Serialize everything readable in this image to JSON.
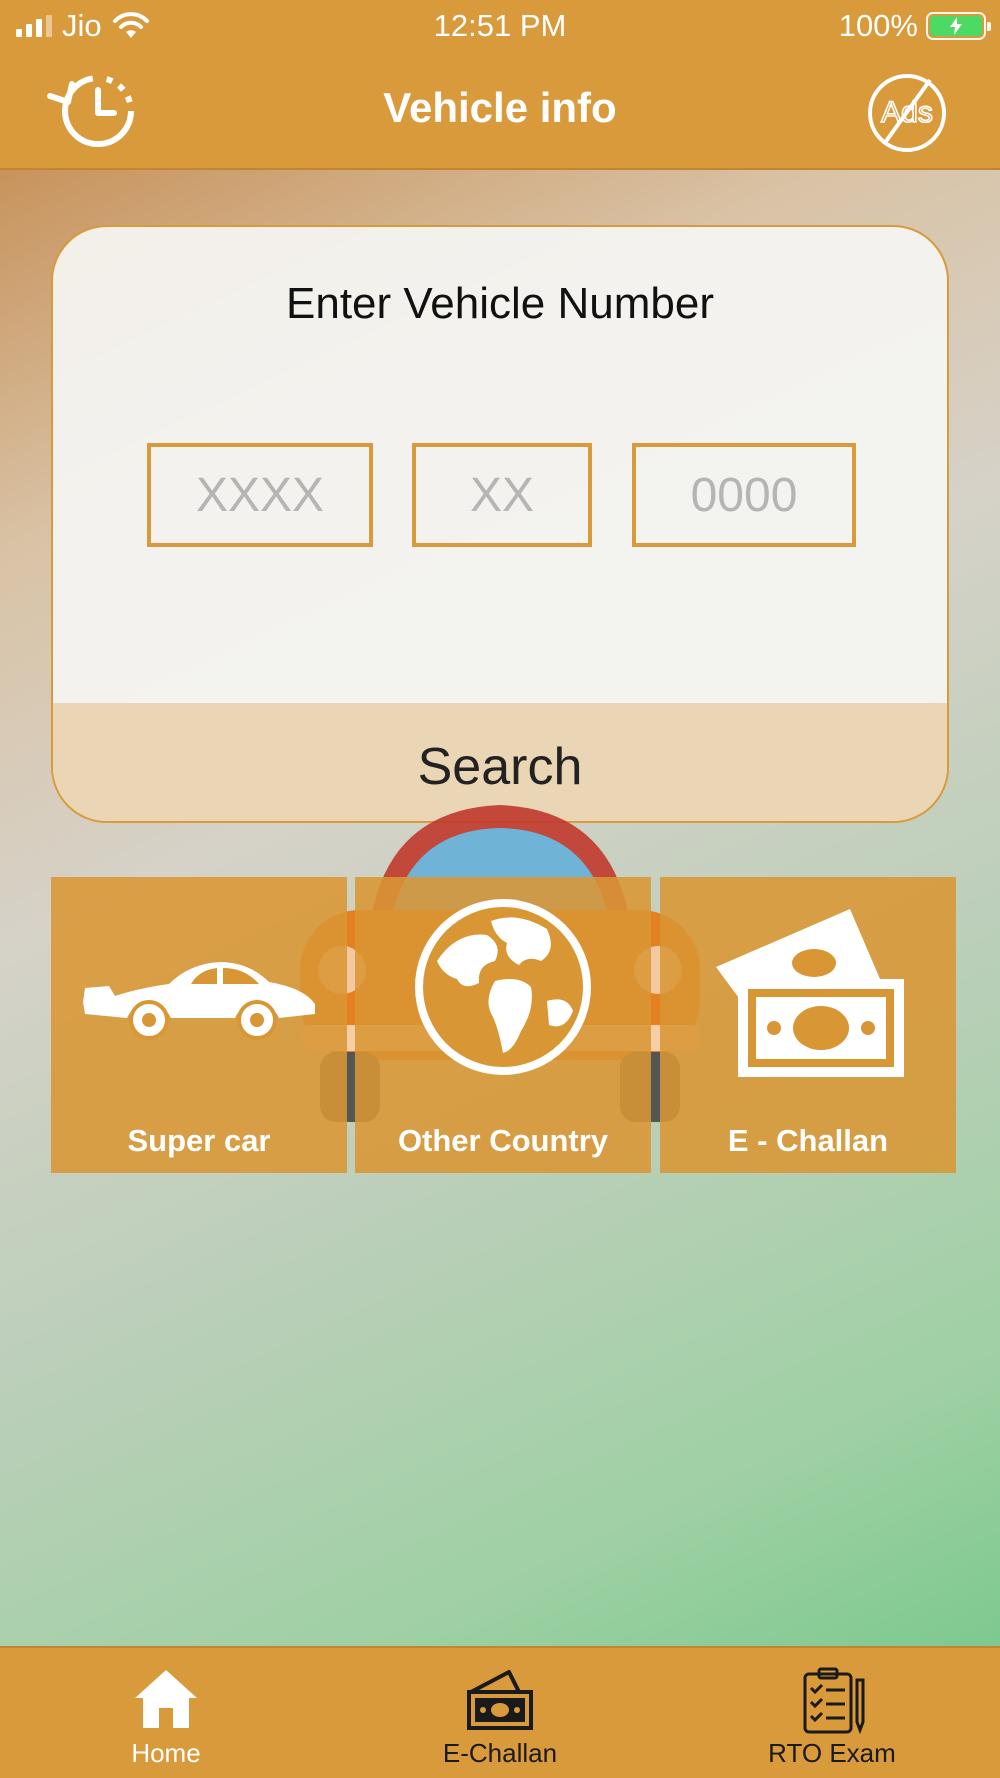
{
  "status_bar": {
    "carrier": "Jio",
    "time": "12:51 PM",
    "battery": "100%"
  },
  "header": {
    "title": "Vehicle info",
    "history_icon": "history-clock-icon",
    "ads_icon": "no-ads-icon",
    "ads_text": "Ads"
  },
  "search_card": {
    "title": "Enter Vehicle Number",
    "fields": [
      {
        "placeholder": "XXXX",
        "value": ""
      },
      {
        "placeholder": "XX",
        "value": ""
      },
      {
        "placeholder": "0000",
        "value": ""
      }
    ],
    "search_label": "Search"
  },
  "tiles": [
    {
      "label": "Super car",
      "icon": "sports-car-icon"
    },
    {
      "label": "Other Country",
      "icon": "globe-icon"
    },
    {
      "label": "E - Challan",
      "icon": "money-icon"
    }
  ],
  "tabbar": {
    "items": [
      {
        "label": "Home",
        "icon": "home-icon",
        "active": true
      },
      {
        "label": "E-Challan",
        "icon": "money-hand-icon",
        "active": false
      },
      {
        "label": "RTO Exam",
        "icon": "clipboard-checklist-icon",
        "active": false
      }
    ]
  },
  "colors": {
    "accent": "#d99a3b",
    "active_tab": "#ffffff",
    "inactive_tab": "#1a1a1a"
  }
}
